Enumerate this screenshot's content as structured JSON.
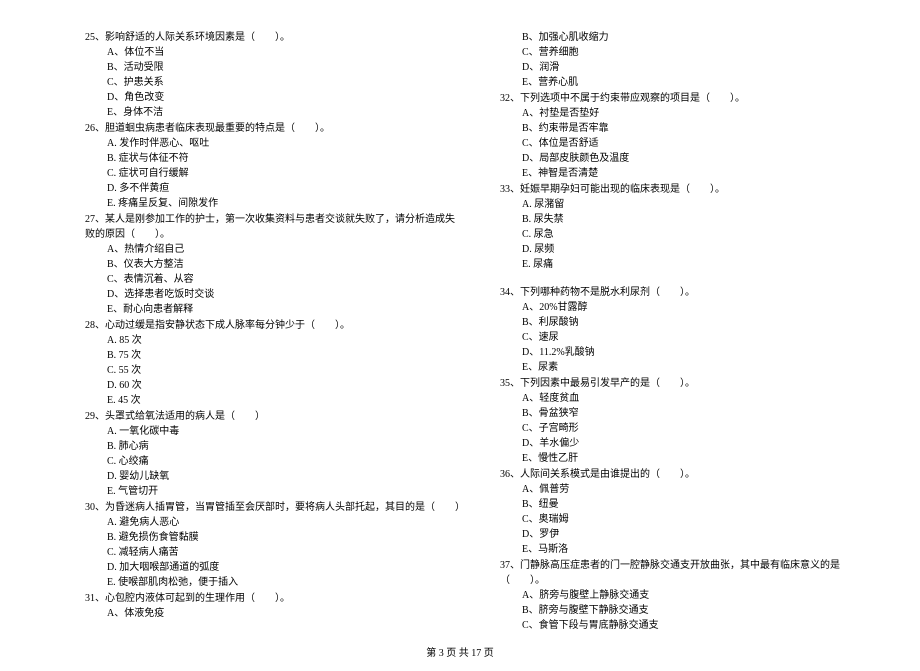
{
  "left": {
    "q25": {
      "stem": "25、影响舒适的人际关系环境因素是（　　）。",
      "opts": [
        "A、体位不当",
        "B、活动受限",
        "C、护患关系",
        "D、角色改变",
        "E、身体不洁"
      ]
    },
    "q26": {
      "stem": "26、胆道蛔虫病患者临床表现最重要的特点是（　　）。",
      "opts": [
        "A. 发作时伴恶心、呕吐",
        "B. 症状与体征不符",
        "C. 症状可自行缓解",
        "D. 多不伴黄疸",
        "E. 疼痛呈反复、间隙发作"
      ]
    },
    "q27": {
      "stem": "27、某人是刚参加工作的护士，第一次收集资料与患者交谈就失败了，请分析造成失败的原因（　　）。",
      "opts": [
        "A、热情介绍自己",
        "B、仪表大方整洁",
        "C、表情沉着、从容",
        "D、选择患者吃饭时交谈",
        "E、耐心向患者解释"
      ]
    },
    "q28": {
      "stem": "28、心动过缓是指安静状态下成人脉率每分钟少于（　　）。",
      "opts": [
        "A. 85 次",
        "B. 75 次",
        "C. 55 次",
        "D. 60 次",
        "E. 45 次"
      ]
    },
    "q29": {
      "stem": "29、头罩式给氧法适用的病人是（　　）",
      "opts": [
        "A. 一氧化碳中毒",
        "B. 肺心病",
        "C. 心绞痛",
        "D. 婴幼儿缺氧",
        "E. 气管切开"
      ]
    },
    "q30": {
      "stem": "30、为昏迷病人插胃管，当胃管插至会厌部时，要将病人头部托起，其目的是（　　）",
      "opts": [
        "A. 避免病人恶心",
        "B. 避免损伤食管黏膜",
        "C. 减轻病人痛苦",
        "D. 加大咽喉部通道的弧度",
        "E. 使喉部肌肉松弛，便于插入"
      ]
    },
    "q31": {
      "stem": "31、心包腔内液体可起到的生理作用（　　）。",
      "opts_partial": [
        "A、体液免疫"
      ]
    }
  },
  "right": {
    "q31_cont": {
      "opts": [
        "B、加强心肌收缩力",
        "C、营养细胞",
        "D、润滑",
        "E、营养心肌"
      ]
    },
    "q32": {
      "stem": "32、下列选项中不属于约束带应观察的项目是（　　）。",
      "opts": [
        "A、衬垫是否垫好",
        "B、约束带是否牢靠",
        "C、体位是否舒适",
        "D、局部皮肤颜色及温度",
        "E、神智是否清楚"
      ]
    },
    "q33": {
      "stem": "33、妊娠早期孕妇可能出现的临床表现是（　　）。",
      "opts": [
        "A. 尿潴留",
        "B. 尿失禁",
        "C. 尿急",
        "D. 尿频",
        "E. 尿痛"
      ]
    },
    "q34": {
      "stem": "34、下列哪种药物不是脱水利尿剂（　　）。",
      "opts": [
        "A、20%甘露醇",
        "B、利尿酸钠",
        "C、速尿",
        "D、11.2%乳酸钠",
        "E、尿素"
      ]
    },
    "q35": {
      "stem": "35、下列因素中最易引发早产的是（　　）。",
      "opts": [
        "A、轻度贫血",
        "B、骨盆狭窄",
        "C、子宫畸形",
        "D、羊水偏少",
        "E、慢性乙肝"
      ]
    },
    "q36": {
      "stem": "36、人际间关系模式是由谁提出的（　　）。",
      "opts": [
        "A、佩普劳",
        "B、纽曼",
        "C、奥瑞姆",
        "D、罗伊",
        "E、马斯洛"
      ]
    },
    "q37": {
      "stem": "37、门静脉高压症患者的门一腔静脉交通支开放曲张，其中最有临床意义的是（　　）。",
      "opts_partial": [
        "A、脐旁与腹壁上静脉交通支",
        "B、脐旁与腹壁下静脉交通支",
        "C、食管下段与胃底静脉交通支"
      ]
    }
  },
  "footer": {
    "text": "第 3 页  共 17 页"
  }
}
